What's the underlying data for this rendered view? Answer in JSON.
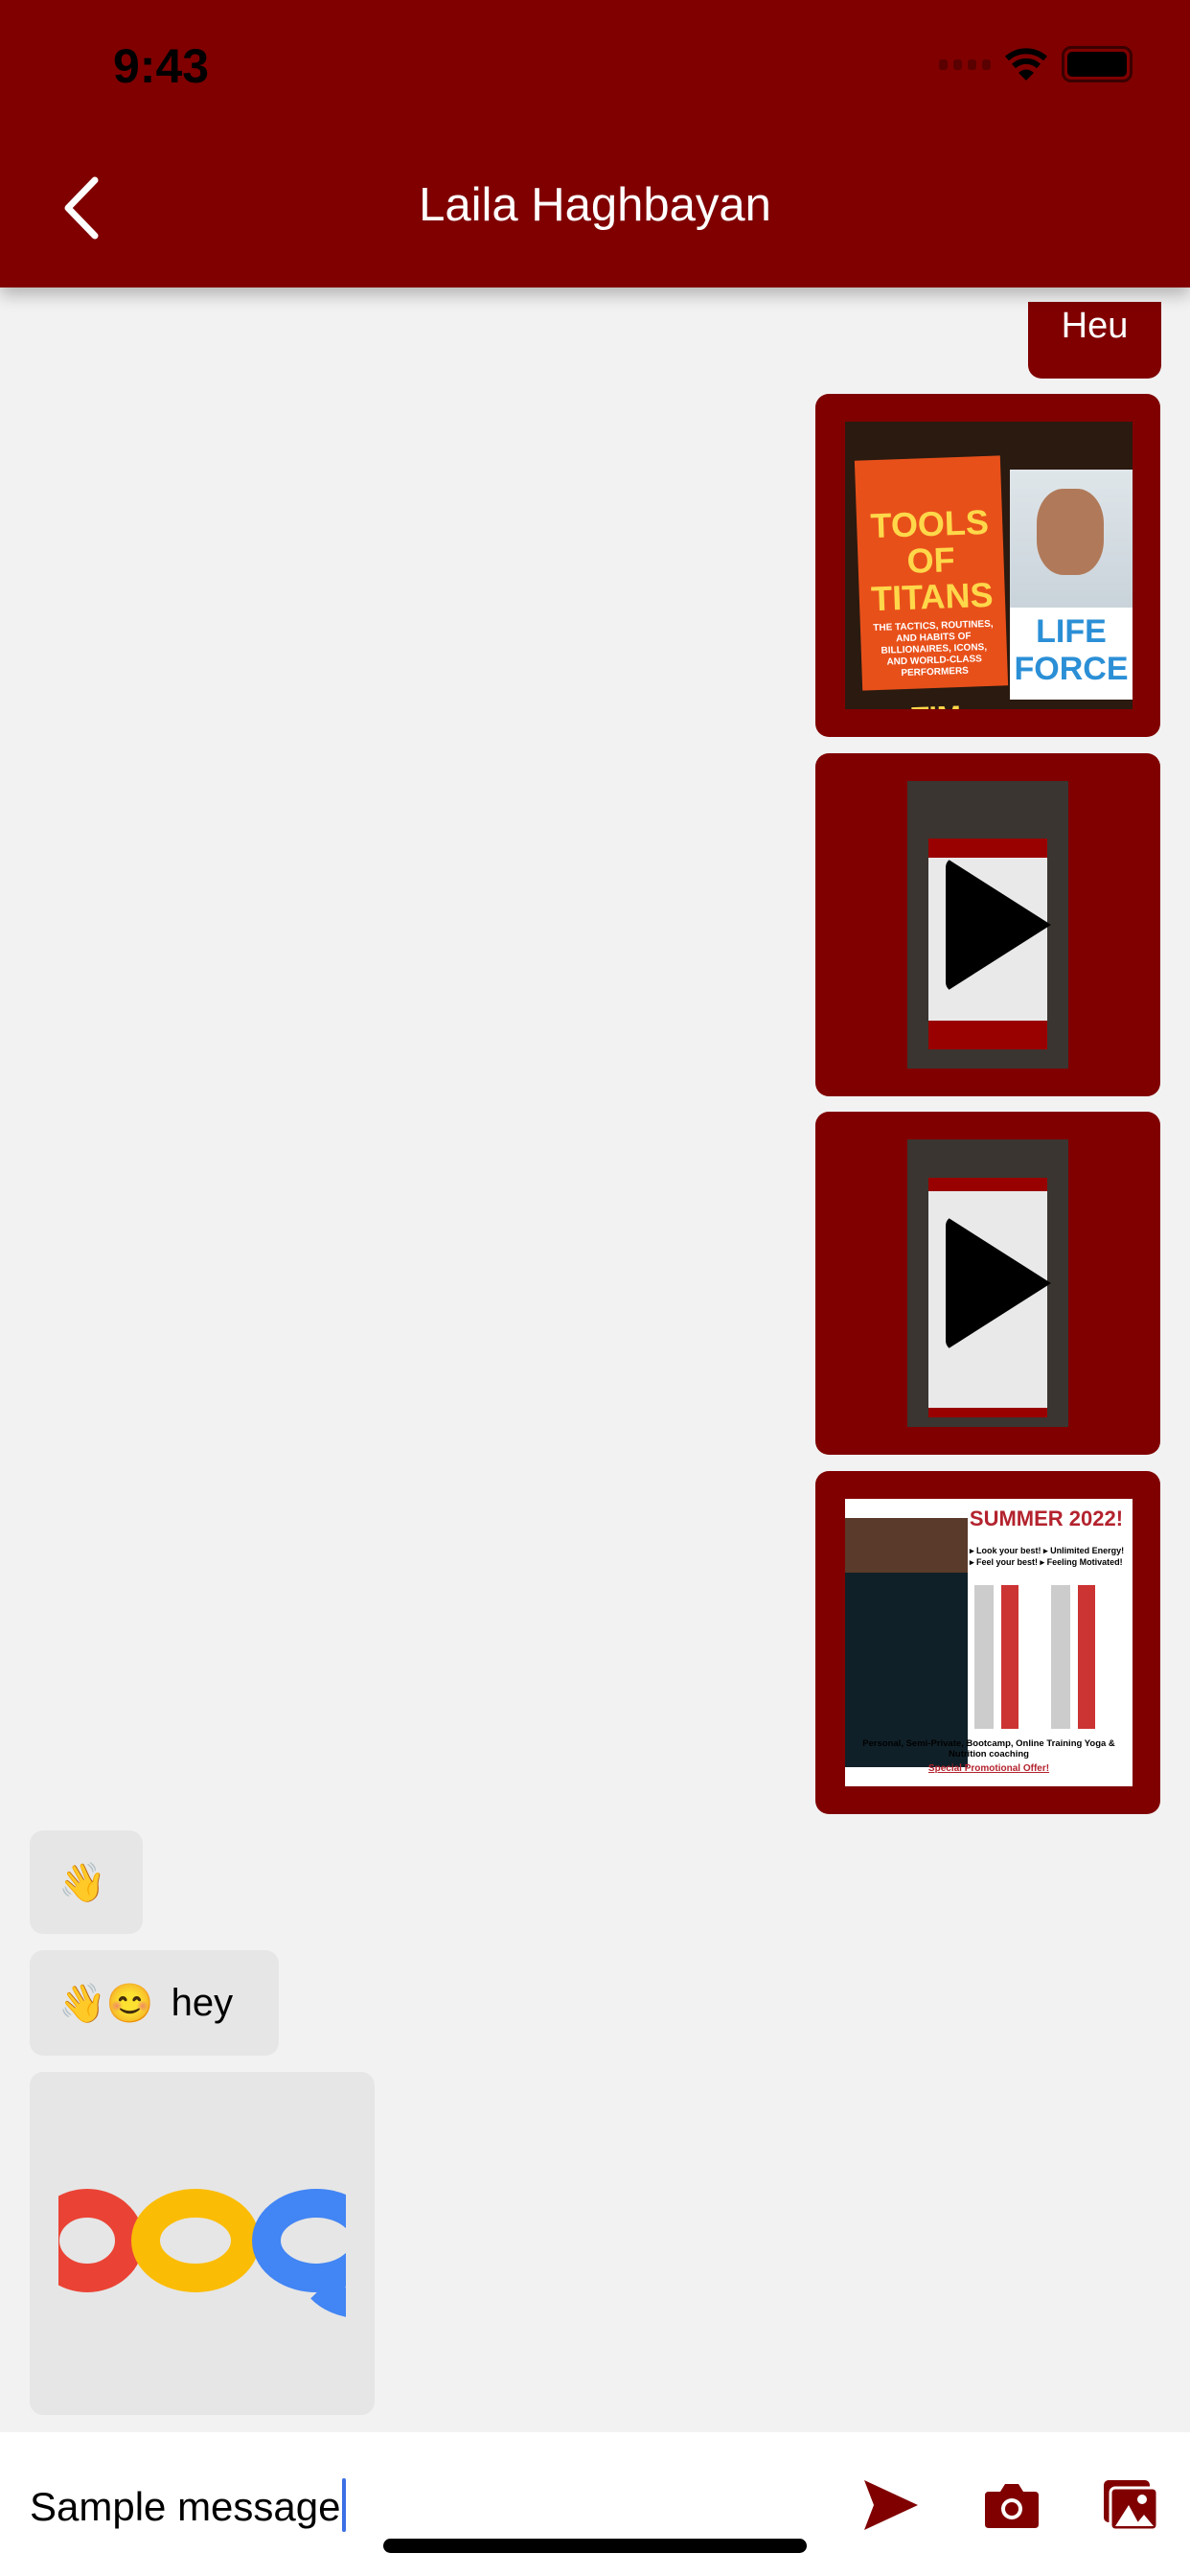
{
  "status_bar": {
    "time": "9:43"
  },
  "header": {
    "title": "Laila Haghbayan",
    "back_icon": "chevron-left-icon"
  },
  "colors": {
    "brand": "#800000",
    "background": "#f2f2f2",
    "received_bubble": "#e6e6e6",
    "cursor": "#3b6fe6"
  },
  "messages": [
    {
      "direction": "sent",
      "type": "text",
      "text": "Heu"
    },
    {
      "direction": "sent",
      "type": "image",
      "image_text": {
        "book1_title": "TOOLS OF TITANS",
        "book1_subtitle": "THE TACTICS, ROUTINES, AND HABITS OF BILLIONAIRES, ICONS, AND WORLD-CLASS PERFORMERS",
        "book1_author": "TIM FERRISS",
        "book2_title": "LIFE FORCE"
      }
    },
    {
      "direction": "sent",
      "type": "video",
      "icon": "play-icon"
    },
    {
      "direction": "sent",
      "type": "video",
      "icon": "play-icon"
    },
    {
      "direction": "sent",
      "type": "image",
      "image_text": {
        "title": "SUMMER 2022!",
        "bullets": [
          "Look your best!",
          "Unlimited Energy!",
          "Feel your best!",
          "Feeling Motivated!"
        ],
        "footer": "Personal, Semi-Private, Bootcamp, Online Training Yoga & Nutrition coaching",
        "offer": "Special Promotional Offer!"
      }
    },
    {
      "direction": "received",
      "type": "text",
      "text": "👋"
    },
    {
      "direction": "received",
      "type": "text",
      "emoji": "👋😊",
      "text": "hey"
    },
    {
      "direction": "received",
      "type": "image"
    }
  ],
  "composer": {
    "value": "Sample message",
    "send_icon": "send-icon",
    "camera_icon": "camera-icon",
    "gallery_icon": "gallery-icon"
  }
}
